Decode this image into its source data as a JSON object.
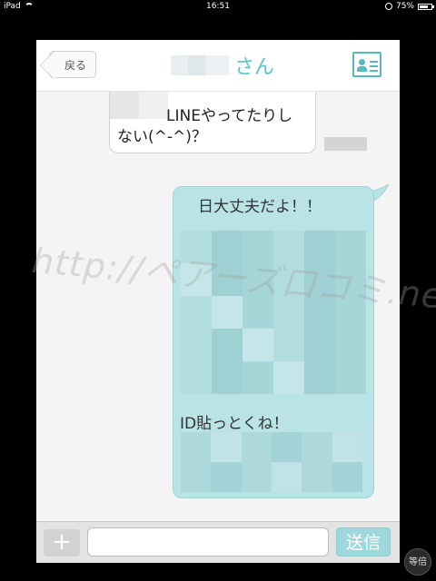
{
  "statusbar": {
    "device": "iPad",
    "time": "16:51",
    "battery": "75%",
    "battery_level": 0.75
  },
  "navbar": {
    "back_label": "戻る",
    "title_suffix": "さん",
    "right_icon": "profile-card-icon"
  },
  "messages": {
    "received": {
      "line1": "LINEやってたりし",
      "line2": "ない(^-^)？"
    },
    "sent": {
      "line1": "日大丈夫だよ！！",
      "line2": "ID貼っとくね！"
    }
  },
  "watermark": "http://ペアーズ口コミ.net/",
  "input_bar": {
    "plus_label": "+",
    "input_value": "",
    "send_label": "送信"
  },
  "zoom_label": "等倍",
  "colors": {
    "accent": "#5ec3c7",
    "sent_bubble": "#b9e3e5",
    "send_button": "#9fd8dc"
  }
}
